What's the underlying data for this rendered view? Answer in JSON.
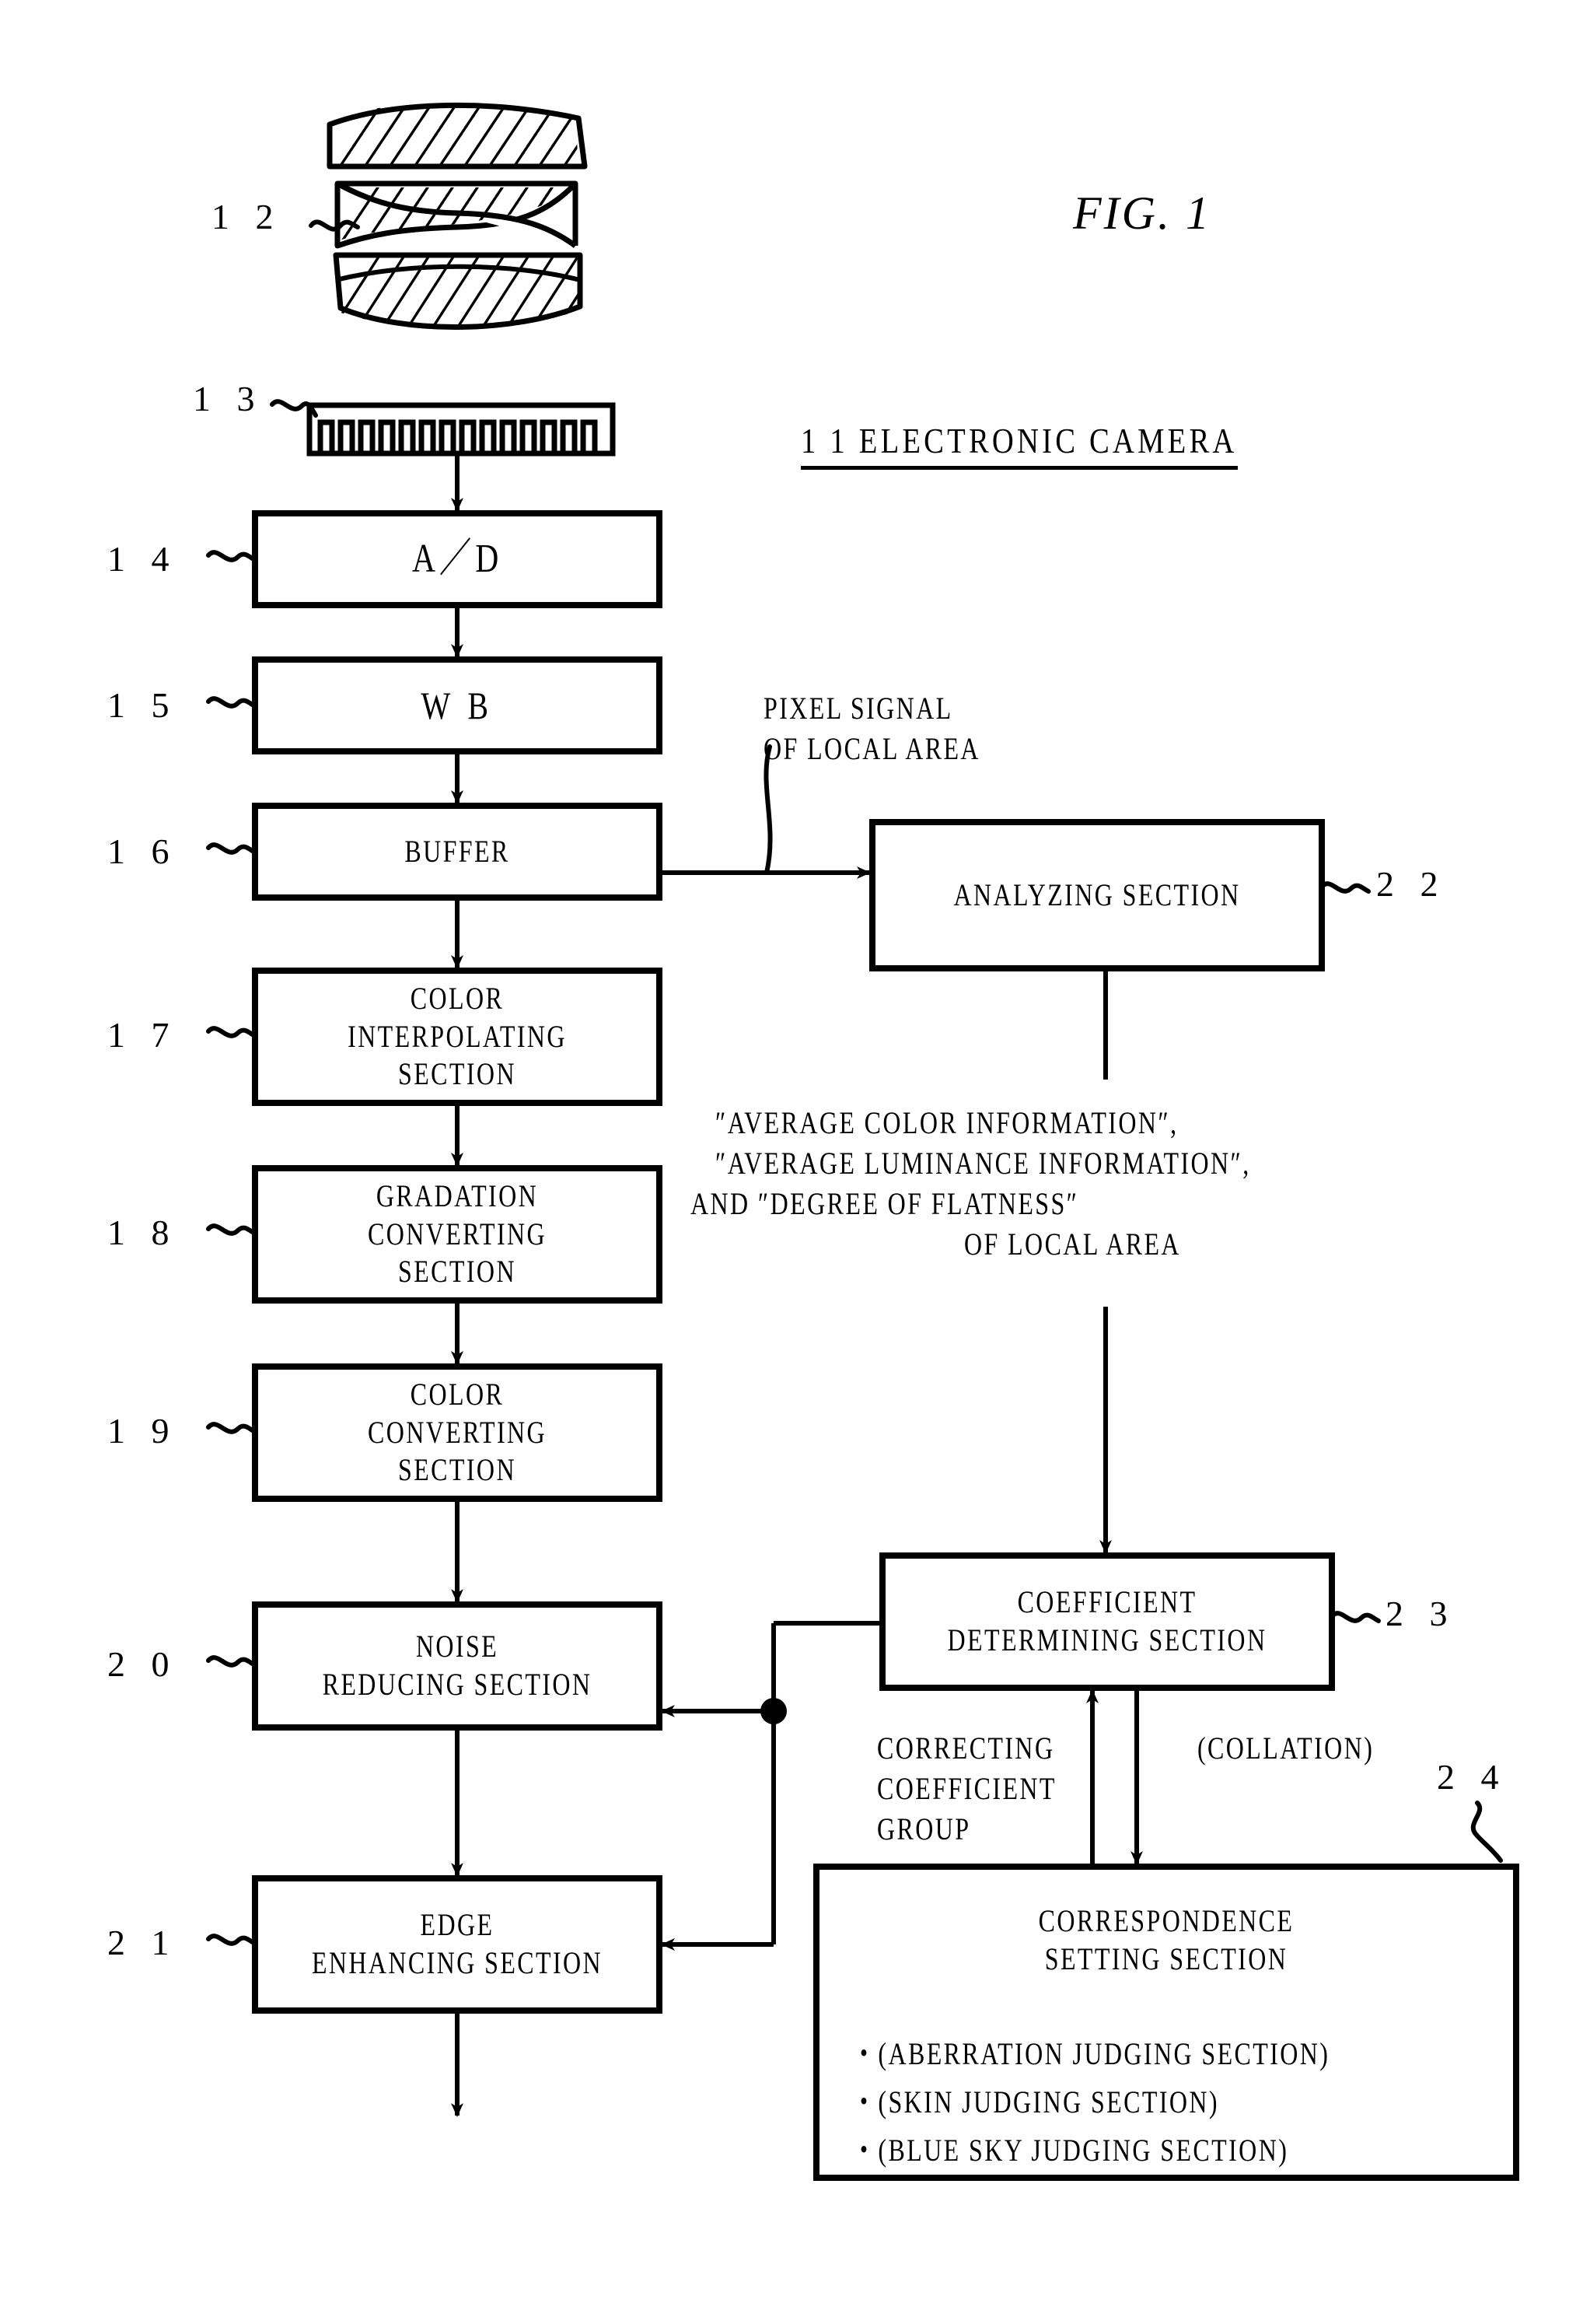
{
  "figure": {
    "title": "FIG. 1",
    "system_label": "1 1  ELECTRONIC CAMERA"
  },
  "optics": {
    "lens_ref": "1 2",
    "sensor_ref": "1 3"
  },
  "pipeline": [
    {
      "ref": "1 4",
      "lines": [
        "A／D"
      ]
    },
    {
      "ref": "1 5",
      "lines": [
        "W B"
      ]
    },
    {
      "ref": "1 6",
      "lines": [
        "BUFFER"
      ]
    },
    {
      "ref": "1 7",
      "lines": [
        "COLOR",
        "INTERPOLATING",
        "SECTION"
      ]
    },
    {
      "ref": "1 8",
      "lines": [
        "GRADATION",
        "CONVERTING",
        "SECTION"
      ]
    },
    {
      "ref": "1 9",
      "lines": [
        "COLOR",
        "CONVERTING",
        "SECTION"
      ]
    },
    {
      "ref": "2 0",
      "lines": [
        "NOISE",
        "REDUCING SECTION"
      ]
    },
    {
      "ref": "2 1",
      "lines": [
        "EDGE",
        "ENHANCING SECTION"
      ]
    }
  ],
  "right_blocks": {
    "analyzing": {
      "ref": "2 2",
      "lines": [
        "ANALYZING SECTION"
      ]
    },
    "coefficient": {
      "ref": "2 3",
      "lines": [
        "COEFFICIENT",
        "DETERMINING SECTION"
      ]
    },
    "correspondence": {
      "ref": "2 4",
      "lines": [
        "CORRESPONDENCE",
        "SETTING SECTION"
      ],
      "bullets": [
        "・(ABERRATION JUDGING SECTION)",
        "・(SKIN JUDGING SECTION)",
        "・(BLUE SKY JUDGING SECTION)"
      ]
    }
  },
  "annotations": {
    "pixel_signal": "PIXEL SIGNAL\nOF LOCAL AREA",
    "analysis_output_l1": "″AVERAGE COLOR INFORMATION″,",
    "analysis_output_l2": "″AVERAGE LUMINANCE INFORMATION″,",
    "analysis_output_l3": "AND ″DEGREE OF FLATNESS″",
    "analysis_output_l4": "OF LOCAL AREA",
    "correcting_coefficient": "CORRECTING\nCOEFFICIENT\nGROUP",
    "collation": "(COLLATION)"
  },
  "colors": {
    "ink": "#000000",
    "paper": "#ffffff"
  }
}
